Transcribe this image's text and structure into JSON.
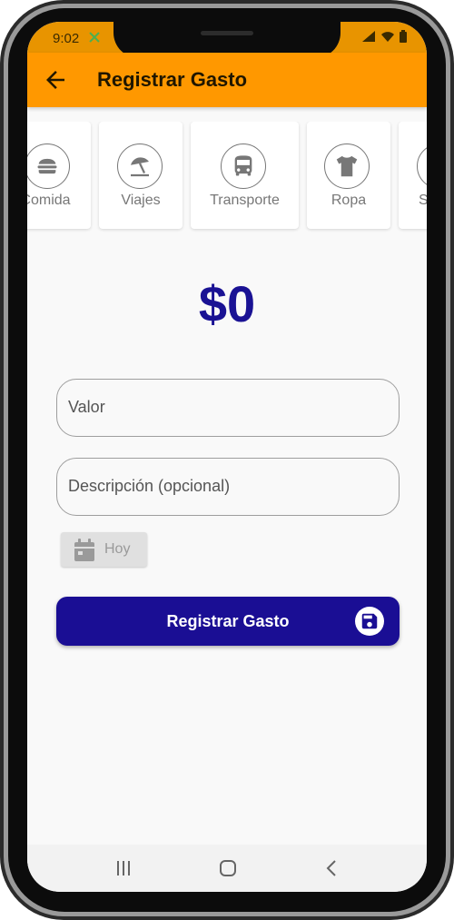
{
  "status_bar": {
    "time": "9:02"
  },
  "app_bar": {
    "title": "Registrar Gasto"
  },
  "categories": [
    {
      "label": "Comida",
      "icon": "burger-icon"
    },
    {
      "label": "Viajes",
      "icon": "beach-umbrella-icon"
    },
    {
      "label": "Transporte",
      "icon": "bus-icon"
    },
    {
      "label": "Ropa",
      "icon": "tshirt-icon"
    },
    {
      "label": "S",
      "icon": "category-icon"
    }
  ],
  "amount": "$0",
  "form": {
    "value_label": "Valor",
    "description_label": "Descripción (opcional)",
    "date_label": "Hoy",
    "submit_label": "Registrar Gasto"
  },
  "colors": {
    "accent": "#ff9800",
    "status_bar": "#e89400",
    "primary": "#1a0e94",
    "amount_text": "#1a1294",
    "background": "#f9f9f9"
  }
}
